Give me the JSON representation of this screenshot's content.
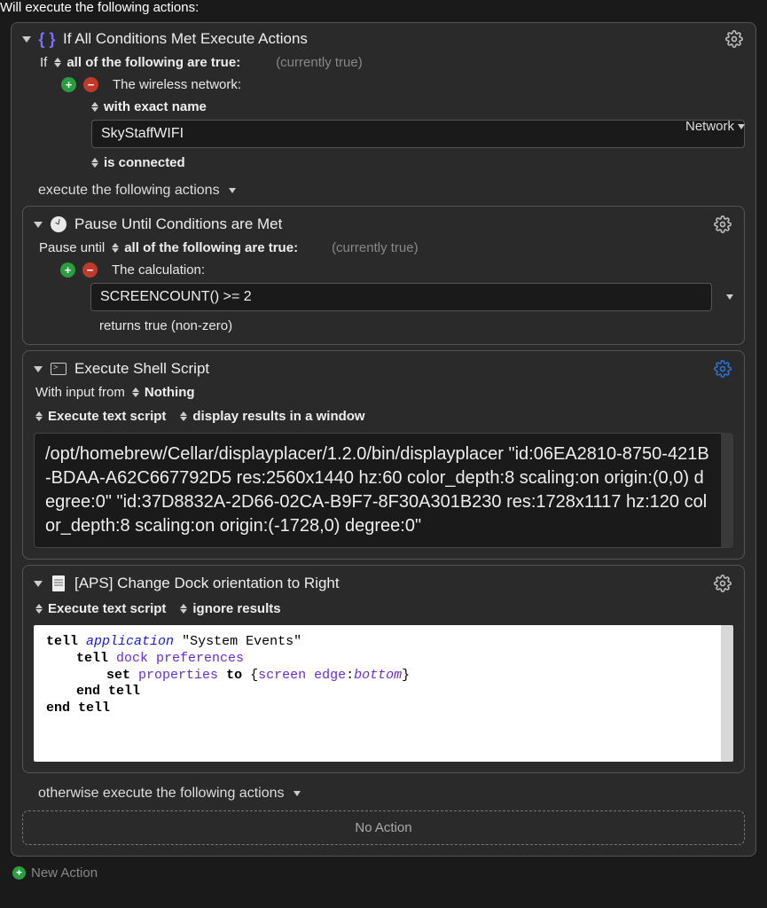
{
  "header": "Will execute the following actions:",
  "main": {
    "title": "If All Conditions Met Execute Actions",
    "if_label": "If",
    "cond_mode": "all of the following are true:",
    "cond_status": "(currently true)",
    "cond1": {
      "subject": "The wireless network:",
      "match": "with exact name",
      "value": "SkyStaffWIFI",
      "state": "is connected",
      "dropdown": "Network"
    },
    "execute_label": "execute the following actions",
    "otherwise_label": "otherwise execute the following actions",
    "no_action": "No Action"
  },
  "pause": {
    "title": "Pause Until Conditions are Met",
    "until_label": "Pause until",
    "cond_mode": "all of the following are true:",
    "cond_status": "(currently true)",
    "subject": "The calculation:",
    "value": "SCREENCOUNT() >= 2",
    "returns": "returns true (non-zero)"
  },
  "shell": {
    "title": "Execute Shell Script",
    "input_label": "With input from",
    "input_value": "Nothing",
    "opt1": "Execute text script",
    "opt2": "display results in a window",
    "script": "/opt/homebrew/Cellar/displayplacer/1.2.0/bin/displayplacer \"id:06EA2810-8750-421B-BDAA-A62C667792D5 res:2560x1440 hz:60 color_depth:8 scaling:on origin:(0,0) degree:0\" \"id:37D8832A-2D66-02CA-B9F7-8F30A301B230 res:1728x1117 hz:120 color_depth:8 scaling:on origin:(-1728,0) degree:0\""
  },
  "apple": {
    "title": "[APS] Change Dock orientation to Right",
    "opt1": "Execute text script",
    "opt2": "ignore results",
    "code": {
      "l1a": "tell",
      "l1b": "application",
      "l1c": "\"System Events\"",
      "l2a": "tell",
      "l2b": "dock preferences",
      "l3a": "set",
      "l3b": "properties",
      "l3c": "to",
      "l3d": "screen edge",
      "l3e": "bottom",
      "l4": "end tell",
      "l5": "end tell"
    }
  },
  "footer": {
    "new_action": "New Action"
  }
}
